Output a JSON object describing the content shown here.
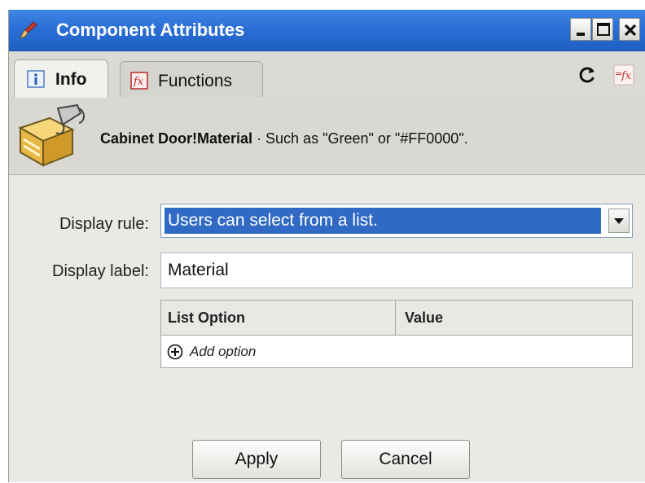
{
  "window": {
    "title": "Component Attributes",
    "controls": [
      "minimize",
      "maximize",
      "close"
    ],
    "accent_color": "#2a6fd6"
  },
  "tabs": [
    {
      "label": "Info",
      "icon": "info-icon",
      "active": true
    },
    {
      "label": "Functions",
      "icon": "fx-icon",
      "active": false
    }
  ],
  "toolbar": {
    "icons": [
      "refresh-icon",
      "fx-insert-icon"
    ]
  },
  "header": {
    "attribute_name": "Cabinet Door!Material",
    "hint": " · Such as \"Green\" or \"#FF0000\".",
    "icon": "paint-bucket-icon"
  },
  "form": {
    "display_rule_label": "Display rule:",
    "display_rule_value": "Users can select from a list.",
    "display_label_label": "Display label:",
    "display_label_value": "Material"
  },
  "options_table": {
    "columns": [
      "List Option",
      "Value"
    ],
    "add_option_label": "Add option"
  },
  "buttons": {
    "apply": "Apply",
    "cancel": "Cancel"
  }
}
